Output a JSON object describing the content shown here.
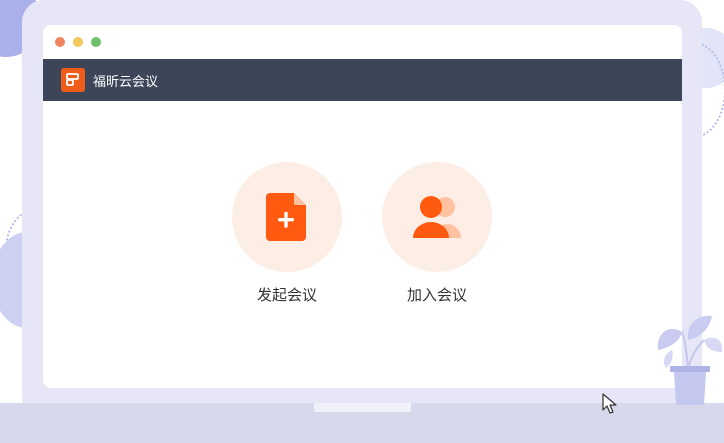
{
  "window": {
    "controls": [
      "close",
      "minimize",
      "maximize"
    ],
    "title": "福昕云会议",
    "logo_icon": "foxit-logo-icon",
    "brand_color": "#f25c19",
    "titlebar_color": "#3c4658"
  },
  "actions": [
    {
      "label": "发起会议",
      "icon": "new-document-plus-icon"
    },
    {
      "label": "加入会议",
      "icon": "participants-icon"
    }
  ],
  "colors": {
    "accent": "#ff5a0f",
    "action_bg": "#fdeee5",
    "frame": "#e6e6f6"
  }
}
